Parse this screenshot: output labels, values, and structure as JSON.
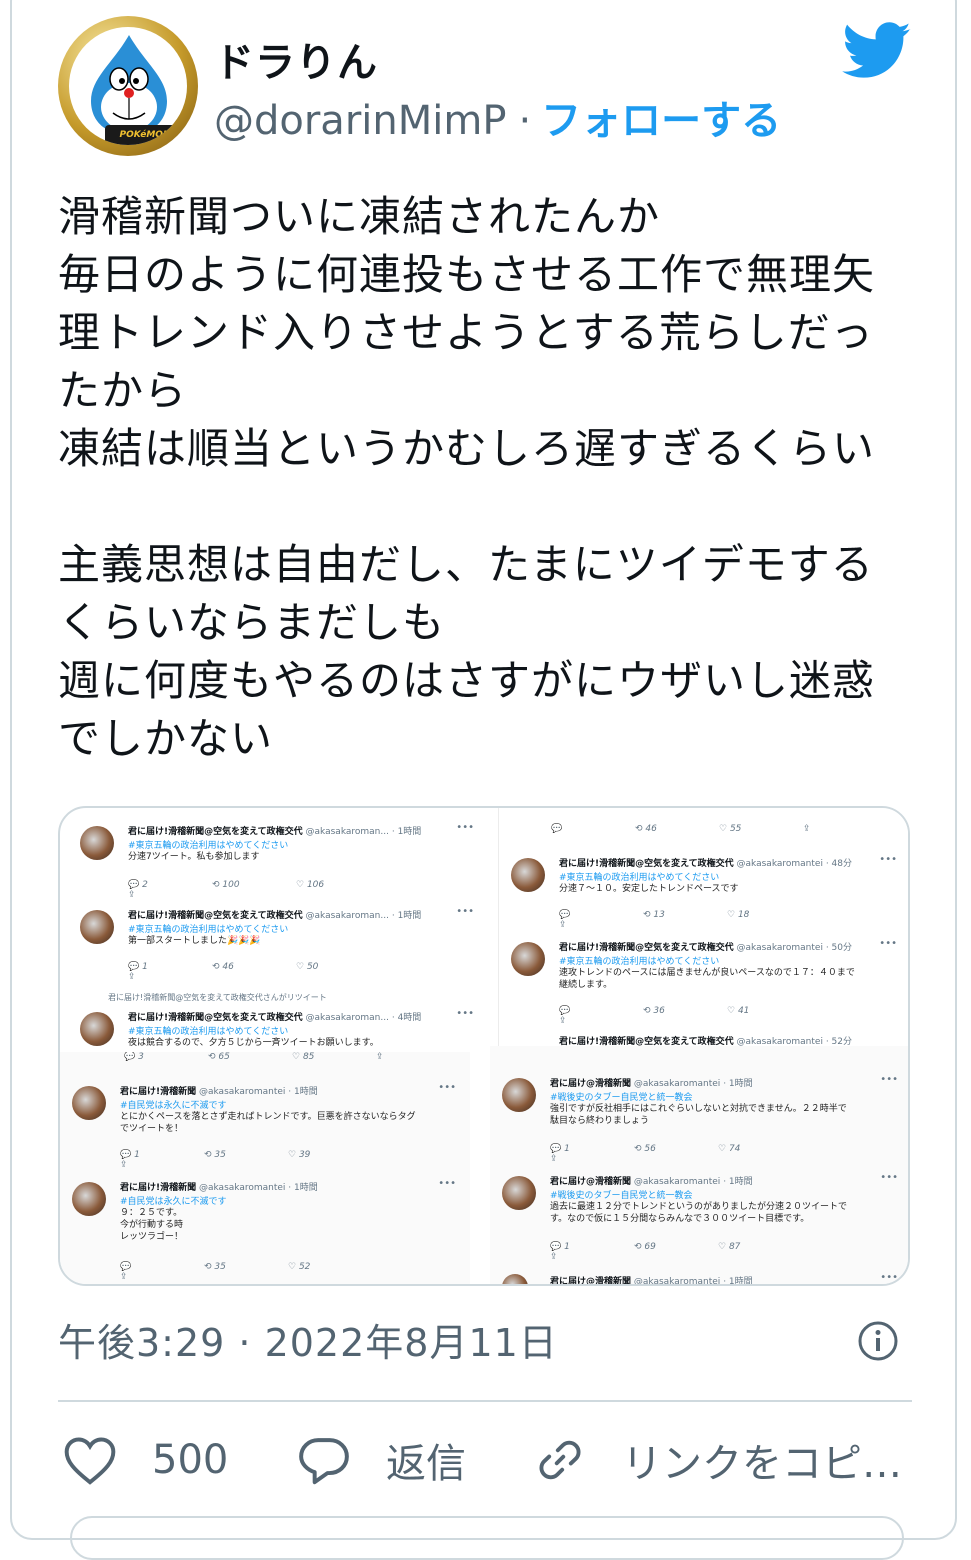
{
  "user": {
    "display_name": "ドラりん",
    "handle": "@dorarinMimP",
    "separator": "·",
    "follow_label": "フォローする",
    "avatar_badge": "POKéMON MASTERS"
  },
  "tweet": {
    "text": "滑稽新聞ついに凍結されたんか\n毎日のように何連投もさせる工作で無理矢\n理トレンド入りさせようとする荒らしだっ\nたから\n凍結は順当というかむしろ遅すぎるくらい\n\n主義思想は自由だし、たまにツイデモする\nくらいならまだしも\n週に何度もやるのはさすがにウザいし迷惑\nでしかない",
    "timestamp": "午後3:29 · 2022年8月11日"
  },
  "media": {
    "panel1": {
      "t1": {
        "name": "君に届け!滑稽新聞@空気を変えて政権交代",
        "handle": "@akasakaroman...",
        "time": "· 1時間",
        "tag": "#東京五輪の政治利用はやめてください",
        "text": "分速7ツイート。私も参加します",
        "rt": "100",
        "like": "106",
        "reply": "2"
      },
      "t2": {
        "name": "君に届け!滑稽新聞@空気を変えて政権交代",
        "handle": "@akasakaroman...",
        "time": "· 1時間",
        "tag": "#東京五輪の政治利用はやめてください",
        "text": "第一部スタートしました🎉🎉🎉",
        "rt": "46",
        "like": "50",
        "reply": "1"
      },
      "rt_note": "君に届け!滑稽新聞@空気を変えて政権交代さんがリツイート",
      "t3": {
        "name": "君に届け!滑稽新聞@空気を変えて政権交代",
        "handle": "@akasakaroman...",
        "time": "· 4時間",
        "tag": "#東京五輪の政治利用はやめてください",
        "text": "夜は競合するので、夕方５じから一斉ツイートお願いします。",
        "rt": "65",
        "like": "85",
        "reply": "3"
      }
    },
    "panel2": {
      "top_acts": {
        "rt": "46",
        "like": "55"
      },
      "t1": {
        "name": "君に届け!滑稽新聞@空気を変えて政権交代",
        "handle": "@akasakaromantei",
        "time": "· 48分",
        "tag": "#東京五輪の政治利用はやめてください",
        "text": "分速７～１０。安定したトレンドペースです",
        "rt": "13",
        "like": "18"
      },
      "t2": {
        "name": "君に届け!滑稽新聞@空気を変えて政権交代",
        "handle": "@akasakaromantei",
        "time": "· 50分",
        "tag": "#東京五輪の政治利用はやめてください",
        "text": "速攻トレンドのペースには届きませんが良いペースなので１７：４０まで\n継続します。",
        "rt": "36",
        "like": "41"
      },
      "t3": {
        "name": "君に届け!滑稽新聞@空気を変えて政権交代",
        "handle": "@akasakaromantei",
        "time": "· 52分"
      }
    },
    "panel3": {
      "top_acts": {
        "reply": "3",
        "rt": "65",
        "like": "85"
      },
      "t1": {
        "name": "君に届け!滑稽新聞",
        "handle": "@akasakaromantei",
        "time": "· 1時間",
        "tag": "#自民党は永久に不滅です",
        "text": "とにかくペースを落とさず走ればトレンドです。巨悪を許さないならタグ\nでツイートを！",
        "reply": "1",
        "rt": "35",
        "like": "39"
      },
      "t2": {
        "name": "君に届け!滑稽新聞",
        "handle": "@akasakaromantei",
        "time": "· 1時間",
        "tag": "#自民党は永久に不滅です",
        "text": "９：２５です。\n今が行動する時\nレッツラゴー！",
        "rt": "35",
        "like": "52"
      }
    },
    "panel4": {
      "t1": {
        "name": "君に届け@滑稽新聞",
        "handle": "@akasakaromantei",
        "time": "· 1時間",
        "tag": "#戦後史のタブー自民党と統一教会",
        "text": "強引ですが反社相手にはこれぐらいしないと対抗できません。２２時半で\n駄目なら終わりましょう",
        "reply": "1",
        "rt": "56",
        "like": "74"
      },
      "t2": {
        "name": "君に届け@滑稽新聞",
        "handle": "@akasakaromantei",
        "time": "· 1時間",
        "tag": "#戦後史のタブー自民党と統一教会",
        "text": "過去に最速１２分でトレンドというのがありましたが分速２０ツイートで\nす。なので仮に１５分間ならみんなで３００ツイート目標です。",
        "reply": "1",
        "rt": "69",
        "like": "87"
      },
      "t3": {
        "name": "君に届け@滑稽新聞",
        "handle": "@akasakaromantei",
        "time": "· 1時間"
      }
    }
  },
  "actions": {
    "like_count": "500",
    "reply_label": "返信",
    "link_label": "リンクをコピ…"
  },
  "colors": {
    "accent": "#1d9bf0",
    "muted": "#536471",
    "border": "#cfd9de"
  }
}
